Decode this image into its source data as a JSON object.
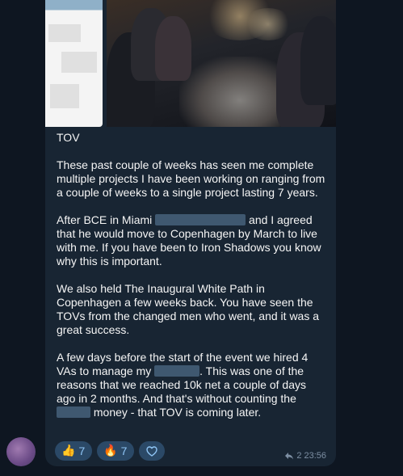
{
  "message": {
    "title": "TOV",
    "para1": "These past couple of weeks has seen me complete multiple projects I have been working on ranging from a couple of weeks to a single project lasting 7 years.",
    "para2_a": "After BCE in Miami",
    "para2_b": "and I agreed that he would move to Copenhagen by March to live with me. If you have been to Iron Shadows you know why this is important.",
    "para3": "We also held The Inaugural White Path in Copenhagen a few weeks back. You have seen the TOVs from the changed men who went, and it was a great success.",
    "para4_a": "A few days before the start of the event we hired 4 VAs to manage my",
    "para4_b": ". This was one of the reasons that we reached 10k net a couple of days ago in 2 months. And that's without counting the",
    "para4_c": "money - that TOV is coming later."
  },
  "reactions": [
    {
      "icon": "thumbs-up-icon",
      "glyph": "👍",
      "count": "7"
    },
    {
      "icon": "fire-icon",
      "glyph": "🔥",
      "count": "7"
    }
  ],
  "meta": {
    "reply_count": "2",
    "time": "23:56"
  },
  "colors": {
    "background": "#0e1621",
    "bubble": "#182533",
    "reaction_pill": "#2b4967",
    "reaction_text": "#8fc5f5"
  }
}
